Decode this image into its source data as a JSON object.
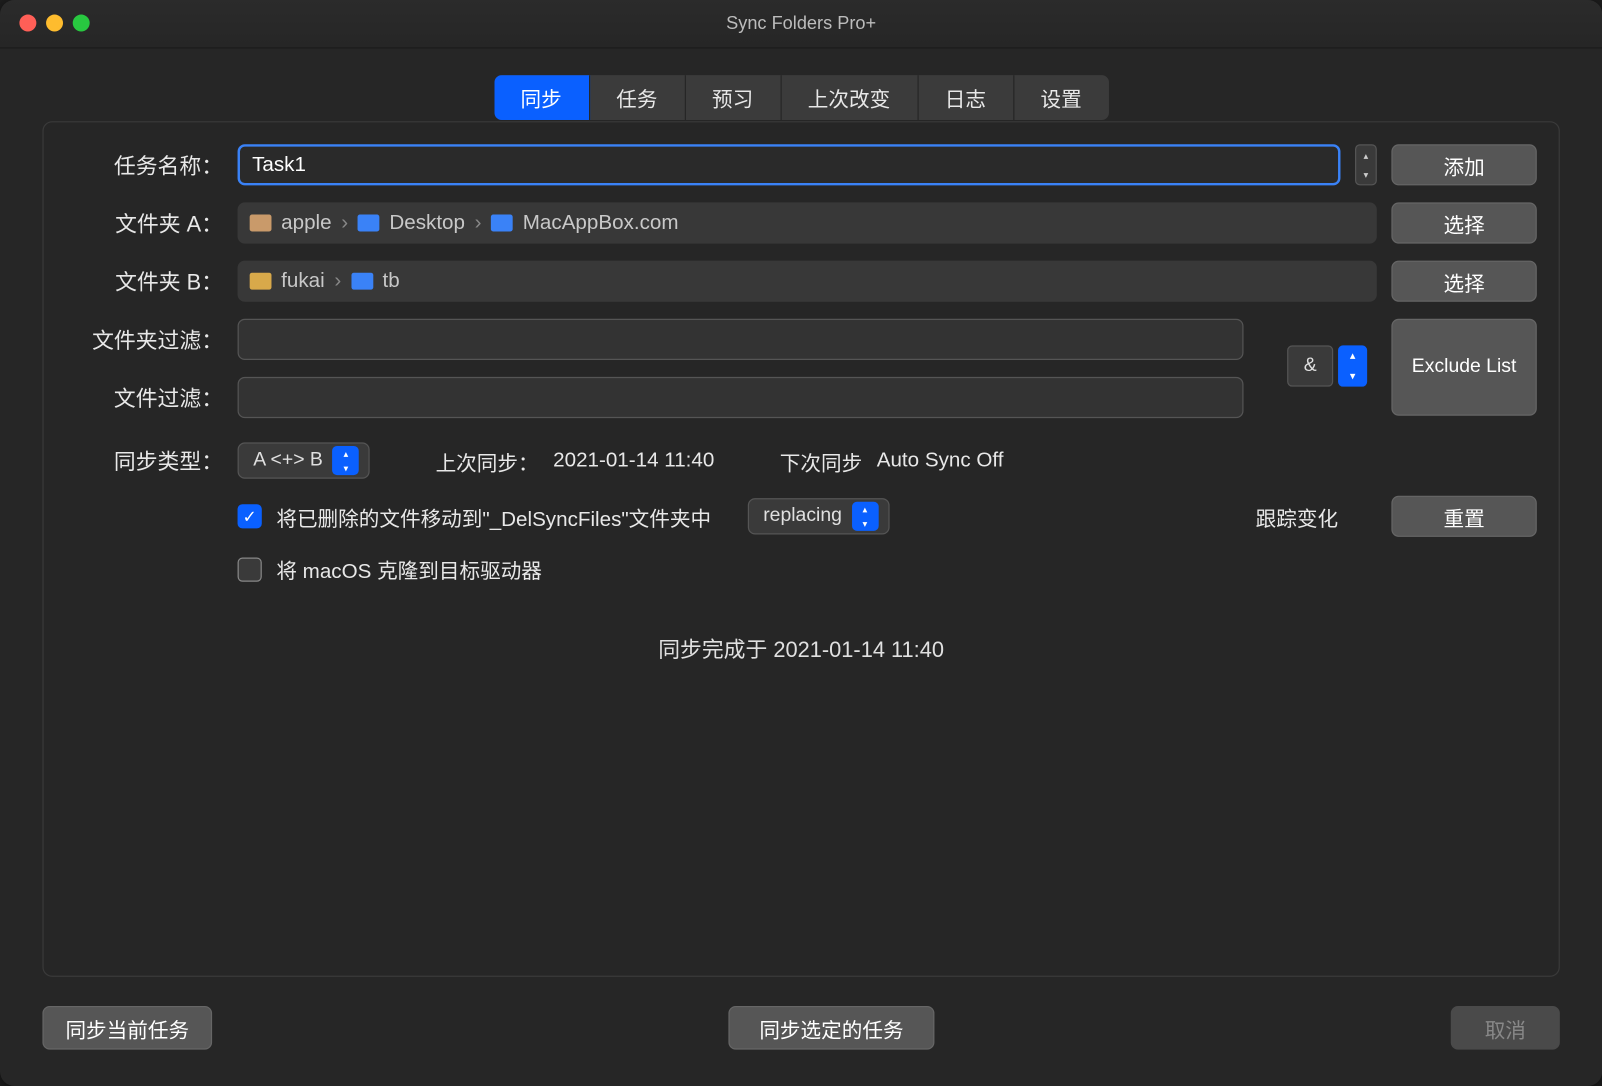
{
  "window": {
    "title": "Sync Folders Pro+"
  },
  "tabs": {
    "items": [
      "同步",
      "任务",
      "预习",
      "上次改变",
      "日志",
      "设置"
    ],
    "active_index": 0
  },
  "form": {
    "task_name_label": "任务名称：",
    "task_name_value": "Task1",
    "add_button": "添加",
    "folder_a_label": "文件夹 A：",
    "folder_a_path": [
      "apple",
      "Desktop",
      "MacAppBox.com"
    ],
    "folder_b_label": "文件夹 B：",
    "folder_b_path": [
      "fukai",
      "tb"
    ],
    "choose_button": "选择",
    "folder_filter_label": "文件夹过滤：",
    "folder_filter_value": "",
    "file_filter_label": "文件过滤：",
    "file_filter_value": "",
    "and_op": "&",
    "exclude_list_button": "Exclude List",
    "sync_type_label": "同步类型：",
    "sync_type_value": "A <+> B",
    "last_sync_label": "上次同步：",
    "last_sync_value": "2021-01-14 11:40",
    "next_sync_label": "下次同步",
    "next_sync_value": "Auto Sync Off",
    "move_deleted_label": "将已删除的文件移动到\"_DelSyncFiles\"文件夹中",
    "move_deleted_checked": true,
    "replacing_value": "replacing",
    "track_changes_label": "跟踪变化",
    "reset_button": "重置",
    "clone_macos_label": "将 macOS 克隆到目标驱动器",
    "clone_macos_checked": false,
    "status_message": "同步完成于 2021-01-14 11:40"
  },
  "bottom": {
    "sync_current": "同步当前任务",
    "sync_selected": "同步选定的任务",
    "cancel": "取消"
  }
}
